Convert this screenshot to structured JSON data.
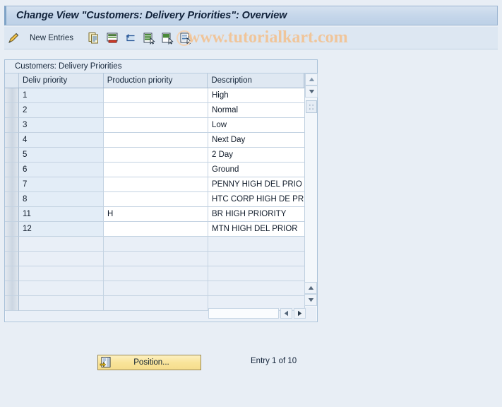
{
  "window": {
    "title": "Change View \"Customers: Delivery Priorities\": Overview"
  },
  "toolbar": {
    "edit_icon": "pencil-icon",
    "new_entries_label": "New Entries",
    "buttons": [
      {
        "name": "copy-icon",
        "title": "Copy As..."
      },
      {
        "name": "delete-icon",
        "title": "Delete"
      },
      {
        "name": "undo-icon",
        "title": "Undo Change"
      },
      {
        "name": "select-all-icon",
        "title": "Select All"
      },
      {
        "name": "select-block-icon",
        "title": "Select Block"
      },
      {
        "name": "deselect-all-icon",
        "title": "Deselect All"
      }
    ]
  },
  "watermark": {
    "text": "www.tutorialkart.com",
    "color": "#f0c59a"
  },
  "panel": {
    "title": "Customers: Delivery Priorities",
    "columns": [
      {
        "key": "delivery_priority",
        "label": "Deliv priority"
      },
      {
        "key": "production_priority",
        "label": "Production priority"
      },
      {
        "key": "description",
        "label": "Description"
      }
    ],
    "config_icon": "column-config-icon",
    "rows": [
      {
        "delivery_priority": "1",
        "production_priority": "",
        "description": "High"
      },
      {
        "delivery_priority": "2",
        "production_priority": "",
        "description": "Normal"
      },
      {
        "delivery_priority": "3",
        "production_priority": "",
        "description": "Low"
      },
      {
        "delivery_priority": "4",
        "production_priority": "",
        "description": "Next Day"
      },
      {
        "delivery_priority": "5",
        "production_priority": "",
        "description": "2 Day"
      },
      {
        "delivery_priority": "6",
        "production_priority": "",
        "description": "Ground"
      },
      {
        "delivery_priority": "7",
        "production_priority": "",
        "description": "PENNY HIGH DEL PRIO"
      },
      {
        "delivery_priority": "8",
        "production_priority": "",
        "description": "HTC CORP HIGH DE PR"
      },
      {
        "delivery_priority": "11",
        "production_priority": "H",
        "description": "BR HIGH PRIORITY"
      },
      {
        "delivery_priority": "12",
        "production_priority": "",
        "description": "MTN HIGH DEL PRIOR"
      }
    ],
    "empty_row_count": 5,
    "scrollbars": {
      "vertical_up": "scroll-up-icon",
      "vertical_down": "scroll-down-icon",
      "horizontal_left": "scroll-left-icon",
      "horizontal_right": "scroll-right-icon"
    }
  },
  "footer": {
    "position_button_label": "Position...",
    "position_button_icon": "position-icon",
    "entry_count_text": "Entry 1 of 10"
  },
  "colors": {
    "title_bar": "#c5d6ea",
    "panel_bg": "#e9eff7",
    "key_column": "#e3edf7",
    "button_yellow": "#f9e49a"
  }
}
